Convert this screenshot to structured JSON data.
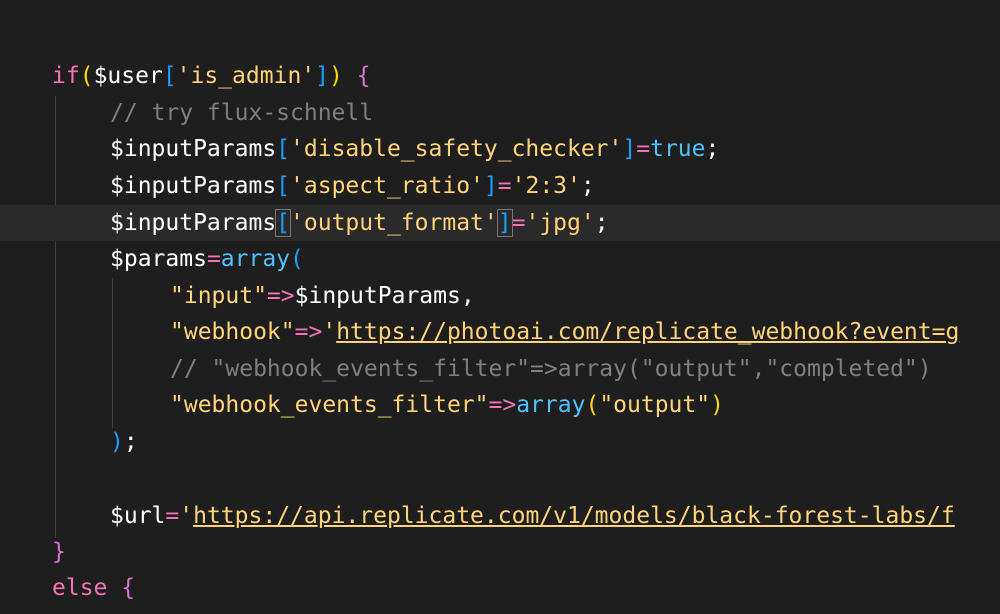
{
  "editor": {
    "theme": {
      "background": "#1e1e1e",
      "current_line": "#2a2a2a",
      "guide": "#404040"
    },
    "lines": [
      {
        "segments": [
          {
            "t": "if",
            "c": "k-pink"
          },
          {
            "t": "(",
            "c": "k-br3"
          },
          {
            "t": "$user",
            "c": "k-plain"
          },
          {
            "t": "[",
            "c": "k-br1"
          },
          {
            "t": "'is_admin'",
            "c": "k-str2"
          },
          {
            "t": "]",
            "c": "k-br1"
          },
          {
            "t": ") ",
            "c": "k-br3"
          },
          {
            "t": "{",
            "c": "k-br2"
          }
        ]
      },
      {
        "segments": [
          {
            "t": "// try flux-schnell",
            "c": "k-cmt"
          }
        ]
      },
      {
        "segments": [
          {
            "t": "$inputParams",
            "c": "k-plain"
          },
          {
            "t": "[",
            "c": "k-br1"
          },
          {
            "t": "'disable_safety_checker'",
            "c": "k-str2"
          },
          {
            "t": "]",
            "c": "k-br1"
          },
          {
            "t": "=",
            "c": "k-pink"
          },
          {
            "t": "true",
            "c": "k-fn"
          },
          {
            "t": ";",
            "c": "k-plain"
          }
        ]
      },
      {
        "segments": [
          {
            "t": "$inputParams",
            "c": "k-plain"
          },
          {
            "t": "[",
            "c": "k-br1"
          },
          {
            "t": "'aspect_ratio'",
            "c": "k-str2"
          },
          {
            "t": "]",
            "c": "k-br1"
          },
          {
            "t": "=",
            "c": "k-pink"
          },
          {
            "t": "'2:3'",
            "c": "k-str2"
          },
          {
            "t": ";",
            "c": "k-plain"
          }
        ]
      },
      {
        "segments": [
          {
            "t": "$inputParams",
            "c": "k-plain"
          },
          {
            "t": "[",
            "c": "k-br1 bracket-match"
          },
          {
            "t": "'output_format'",
            "c": "k-str2"
          },
          {
            "t": "]",
            "c": "k-br1 bracket-match"
          },
          {
            "t": "=",
            "c": "k-pink"
          },
          {
            "t": "'jpg'",
            "c": "k-str2"
          },
          {
            "t": ";",
            "c": "k-plain"
          }
        ]
      },
      {
        "segments": [
          {
            "t": "$params",
            "c": "k-plain"
          },
          {
            "t": "=",
            "c": "k-pink"
          },
          {
            "t": "array",
            "c": "k-fn"
          },
          {
            "t": "(",
            "c": "k-br1"
          }
        ]
      },
      {
        "segments": [
          {
            "t": "\"input\"",
            "c": "k-str2"
          },
          {
            "t": "=>",
            "c": "k-pink"
          },
          {
            "t": "$inputParams",
            "c": "k-plain"
          },
          {
            "t": ",",
            "c": "k-plain"
          }
        ]
      },
      {
        "segments": [
          {
            "t": "\"webhook\"",
            "c": "k-str2"
          },
          {
            "t": "=>",
            "c": "k-pink"
          },
          {
            "t": "'",
            "c": "k-str2"
          },
          {
            "t": "https://photoai.com/replicate_webhook?event=g",
            "c": "k-url"
          }
        ]
      },
      {
        "segments": [
          {
            "t": "// \"webhook_events_filter\"=>array(\"output\",\"completed\")",
            "c": "k-cmt"
          }
        ]
      },
      {
        "segments": [
          {
            "t": "\"webhook_events_filter\"",
            "c": "k-str2"
          },
          {
            "t": "=>",
            "c": "k-pink"
          },
          {
            "t": "array",
            "c": "k-fn"
          },
          {
            "t": "(",
            "c": "k-br3"
          },
          {
            "t": "\"output\"",
            "c": "k-str2"
          },
          {
            "t": ")",
            "c": "k-br3"
          }
        ]
      },
      {
        "segments": [
          {
            "t": ")",
            "c": "k-br1"
          },
          {
            "t": ";",
            "c": "k-plain"
          }
        ]
      },
      {
        "segments": []
      },
      {
        "segments": [
          {
            "t": "$url",
            "c": "k-plain"
          },
          {
            "t": "=",
            "c": "k-pink"
          },
          {
            "t": "'",
            "c": "k-str2"
          },
          {
            "t": "https://api.replicate.com/v1/models/black-forest-labs/f",
            "c": "k-url"
          }
        ]
      },
      {
        "segments": [
          {
            "t": "}",
            "c": "k-br2"
          }
        ]
      },
      {
        "segments": [
          {
            "t": "else ",
            "c": "k-pink"
          },
          {
            "t": "{",
            "c": "k-br2"
          }
        ]
      }
    ]
  }
}
